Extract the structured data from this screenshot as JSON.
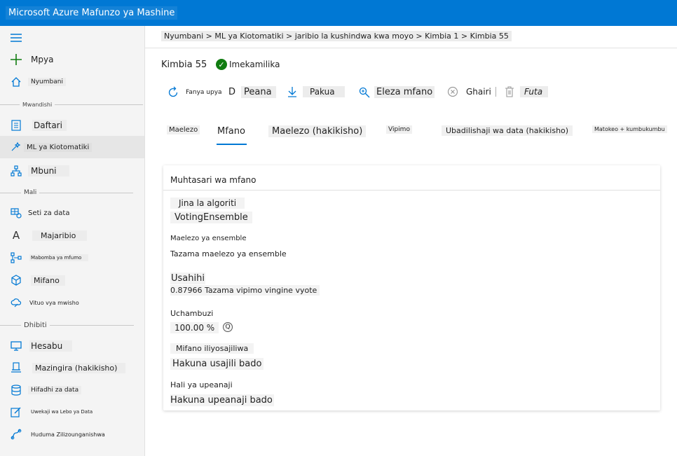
{
  "app": {
    "title": "Microsoft Azure Mafunzo ya Mashine"
  },
  "sidebar": {
    "new_label": "Mpya",
    "home_label": "Nyumbani",
    "section_author": "Mwandishi",
    "notebooks": "Daftari",
    "automl": "ML ya Kiotomatiki",
    "designer": "Mbuni",
    "section_assets": "Mali",
    "datasets": "Seti za data",
    "experiments": "Majaribio",
    "pipelines": "Mabomba ya mfumo",
    "models": "Mifano",
    "endpoints": "Vituo vya mwisho",
    "section_manage": "Dhibiti",
    "compute": "Hesabu",
    "environments": "Mazingira (hakikisho)",
    "datastores": "Hifadhi za data",
    "labeling": "Uwekaji wa Lebo ya Data",
    "linked_services": "Huduma Zilizounganishwa"
  },
  "breadcrumb": "Nyumbani > ML ya Kiotomatiki > jaribio la kushindwa kwa moyo > Kimbia 1 > Kimbia 55",
  "run": {
    "title": "Kimbia 55",
    "status": "Imekamilika",
    "status_color": "#107c10"
  },
  "toolbar": {
    "refresh": "Fanya upya",
    "deploy_icon": "D",
    "deploy": "Peana",
    "download": "Pakua",
    "explain": "Eleza mfano",
    "cancel": "Ghairi",
    "delete": "Futa"
  },
  "tabs": [
    {
      "label": "Maelezo"
    },
    {
      "label": "Mfano"
    },
    {
      "label": "Maelezo (hakikisho)"
    },
    {
      "label": "Vipimo"
    },
    {
      "label": "Ubadilishaji wa data (hakikisho)"
    },
    {
      "label": "Matokeo + kumbukumbu"
    }
  ],
  "summary": {
    "title": "Muhtasari wa mfano",
    "algo_label": "Jina la algoriti",
    "algo_value": "VotingEnsemble",
    "ensemble_label": "Maelezo ya ensemble",
    "ensemble_link": "Tazama maelezo ya ensemble",
    "accuracy_label": "Usahihi",
    "accuracy_value": "0.87966 Tazama vipimo vingine vyote",
    "sampling_label": "Uchambuzi",
    "sampling_value": "100.00 %",
    "registered_label": "Mifano iliyosajiliwa",
    "registered_value": "Hakuna usajili bado",
    "deploy_label": "Hali ya upeanaji",
    "deploy_value": "Hakuna upeanaji bado"
  },
  "colors": {
    "accent": "#0078d4",
    "topbar": "#0078d4",
    "success": "#107c10"
  }
}
